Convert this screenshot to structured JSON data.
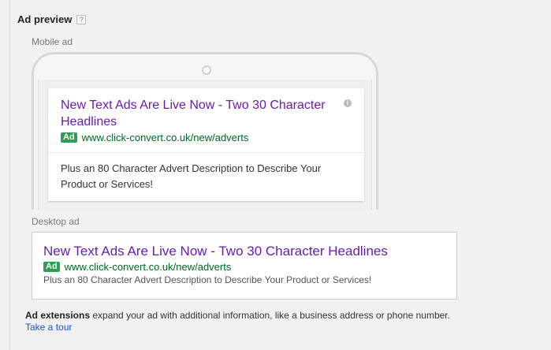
{
  "header": {
    "title": "Ad preview",
    "help": "?"
  },
  "mobile": {
    "label": "Mobile ad",
    "title": "New Text Ads Are Live Now - Two 30 Character Headlines",
    "badge": "Ad",
    "url": "www.click-convert.co.uk/new/adverts",
    "description": "Plus an 80 Character Advert Description to Describe Your Product or Services!",
    "info_icon": "i"
  },
  "desktop": {
    "label": "Desktop ad",
    "title": "New Text Ads Are Live Now - Two 30 Character Headlines",
    "badge": "Ad",
    "url": "www.click-convert.co.uk/new/adverts",
    "description": "Plus an 80 Character Advert Description to Describe Your Product or Services!"
  },
  "extensions": {
    "bold": "Ad extensions",
    "text": " expand your ad with additional information, like a business address or phone number. ",
    "link": "Take a tour"
  }
}
